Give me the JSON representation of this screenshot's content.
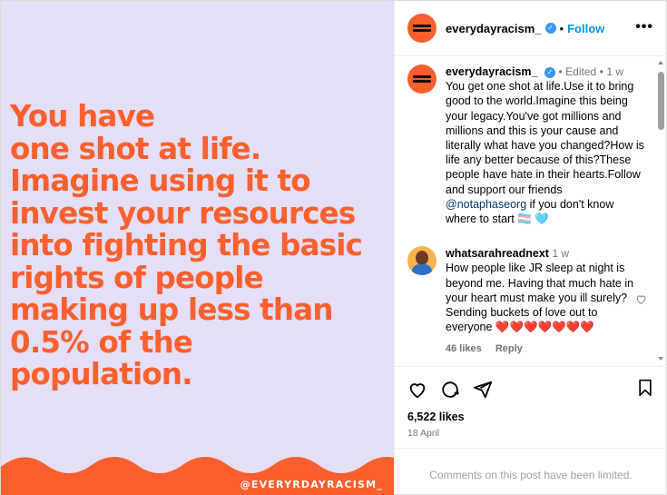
{
  "post_image": {
    "quote_lines": [
      "You have",
      "one shot at life.",
      "Imagine using it to",
      "invest your resources",
      "into fighting the basic",
      "rights of people",
      "making up less than",
      "0.5% of the",
      "population."
    ],
    "watermark": "@EVERYRDAYRACISM_",
    "colors": {
      "background": "#e4def7",
      "accent": "#fa5f2d"
    }
  },
  "header": {
    "username": "everydayracism_",
    "separator": "•",
    "follow_label": "Follow",
    "more_icon": "more-icon",
    "more_glyph": "•••"
  },
  "caption": {
    "username": "everydayracism_",
    "edited": "Edited",
    "separator": "•",
    "time": "1 w",
    "text_before_link": "You get one shot at life.Use it to bring good to the world.Imagine this being your legacy.You've got millions and millions and this is your cause and literally what have you changed?How is life any better because of this?These people have hate in their hearts.Follow and support our friends ",
    "link": "@notaphaseorg",
    "text_after_link": " if you don't know where to start ",
    "emojis": "🏳️‍⚧️ 🩵"
  },
  "comment": {
    "username": "whatsarahreadnext",
    "time": "1 w",
    "text": "How people like JR sleep at night is beyond me. Having that much hate in your heart must make you ill surely? Sending buckets of love out to everyone ",
    "hearts": "❤️❤️❤️❤️❤️❤️❤️",
    "likes": "46 likes",
    "reply_label": "Reply"
  },
  "actions": {
    "likes": "6,522 likes",
    "date": "18 April"
  },
  "footer": {
    "limited_text": "Comments on this post have been limited."
  }
}
